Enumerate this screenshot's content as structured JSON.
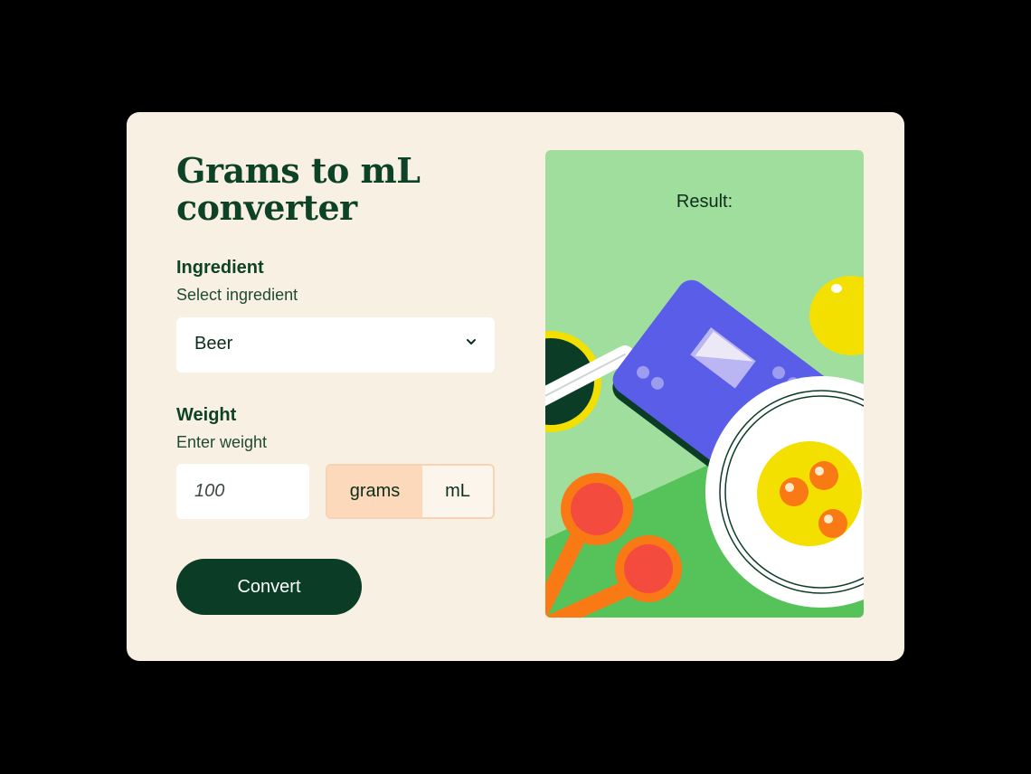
{
  "converter": {
    "title": "Grams to mL converter",
    "ingredient": {
      "label": "Ingredient",
      "hint": "Select ingredient",
      "selected": "Beer"
    },
    "weight": {
      "label": "Weight",
      "hint": "Enter weight",
      "placeholder": "100",
      "units": [
        "grams",
        "mL"
      ],
      "active_unit": "grams"
    },
    "convert_label": "Convert"
  },
  "result": {
    "label": "Result:"
  },
  "icons": {
    "select_chevron": "chevron-down-icon"
  },
  "colors": {
    "brand_dark": "#0b3d26",
    "card_bg": "#f8f0e3",
    "active_unit_bg": "#fcd9bb",
    "result_bg": "#a0de9d"
  }
}
